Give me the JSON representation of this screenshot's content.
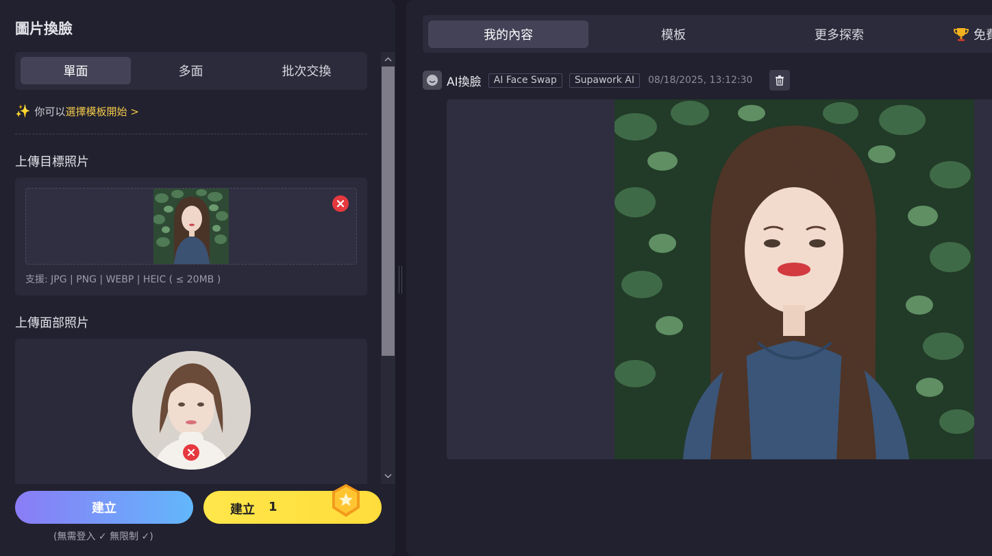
{
  "left": {
    "title": "圖片換臉",
    "mode_tabs": [
      "單面",
      "多面",
      "批次交換"
    ],
    "tip_prefix": "你可以",
    "tip_link": "選擇模板開始 >",
    "target_label": "上傳目標照片",
    "support_text": "支援: JPG | PNG | WEBP | HEIC ( ≤ 20MB )",
    "face_label": "上傳面部照片",
    "create_label": "建立",
    "create_coin_label": "建立",
    "create_coin_count": "1",
    "no_login_text": "(無需登入 ✓ 無限制 ✓)"
  },
  "right": {
    "tabs": [
      "我的內容",
      "模板",
      "更多探索"
    ],
    "free_tab_label": "免費",
    "record": {
      "app_name": "AI換臉",
      "chips": [
        "AI Face Swap",
        "Supawork AI"
      ],
      "date": "08/18/2025, 13:12:30"
    }
  },
  "icons": {
    "tip": "sparkle-icon",
    "remove": "close-circle-icon",
    "trophy": "trophy-icon",
    "delete": "trash-icon",
    "coin": "coin-icon"
  },
  "colors": {
    "accent_yellow": "#ffe14a",
    "gradient_start": "#8a7cf6",
    "gradient_end": "#62b7fb",
    "remove_red": "#e5393f",
    "link_gold": "#f2c84b"
  }
}
